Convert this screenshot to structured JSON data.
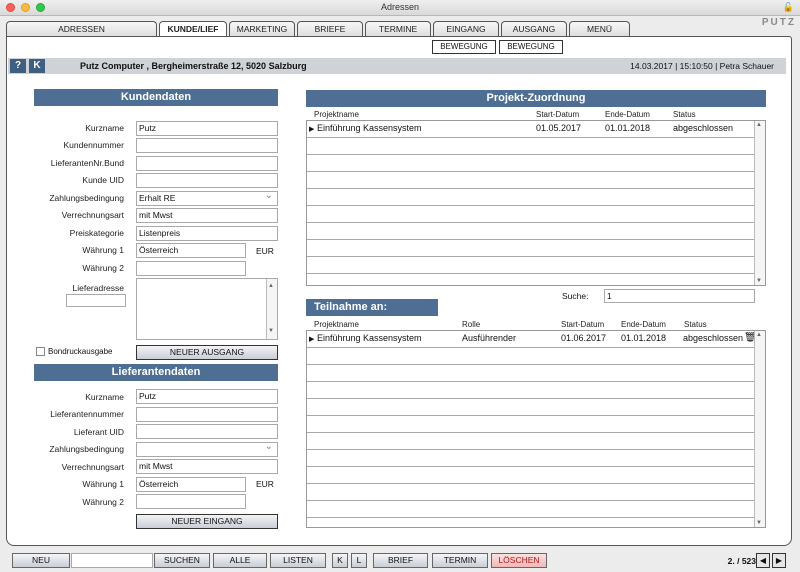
{
  "window": {
    "title": "Adressen",
    "logo": "PUTZ"
  },
  "tabs": [
    "ADRESSEN",
    "KUNDE/LIEF",
    "MARKETING",
    "BRIEFE",
    "TERMINE",
    "EINGANG",
    "AUSGANG",
    "MENÜ"
  ],
  "sub_buttons": [
    "BEWEGUNG",
    "BEWEGUNG"
  ],
  "header": {
    "help": "?",
    "k": "K",
    "company": "Putz Computer , Bergheimerstraße 12, 5020 Salzburg",
    "dateinfo": "14.03.2017 | 15:10:50 | Petra Schauer"
  },
  "kunden": {
    "title": "Kundendaten",
    "labels": {
      "kurzname": "Kurzname",
      "kundennummer": "Kundennummer",
      "lieferanten_bund": "LieferantenNr.Bund",
      "kunde_uid": "Kunde UID",
      "zahlungsbedingung": "Zahlungsbedingung",
      "verrechnungsart": "Verrechnungsart",
      "preiskategorie": "Preiskategorie",
      "waehrung1": "Währung 1",
      "waehrung2": "Währung 2",
      "lieferadresse": "Lieferadresse"
    },
    "values": {
      "kurzname": "Putz",
      "kundennummer": "",
      "lieferanten_bund": "",
      "kunde_uid": "",
      "zahlungsbedingung": "Erhalt RE",
      "verrechnungsart": "mit Mwst",
      "preiskategorie": "Listenpreis",
      "waehrung1": "Österreich",
      "waehrung1_unit": "EUR",
      "waehrung2": ""
    },
    "bondruck": "Bondruckausgabe",
    "button": "NEUER AUSGANG"
  },
  "lieferanten": {
    "title": "Lieferantendaten",
    "labels": {
      "kurzname": "Kurzname",
      "nummer": "Lieferantennummer",
      "uid": "Lieferant UID",
      "zahlungsbedingung": "Zahlungsbedingung",
      "verrechnungsart": "Verrechnungsart",
      "waehrung1": "Währung 1",
      "waehrung2": "Währung 2"
    },
    "values": {
      "kurzname": "Putz",
      "nummer": "",
      "uid": "",
      "zahlungsbedingung": "",
      "verrechnungsart": "mit Mwst",
      "waehrung1": "Österreich",
      "waehrung1_unit": "EUR",
      "waehrung2": ""
    },
    "button": "NEUER EINGANG"
  },
  "projekt": {
    "title": "Projekt-Zuordnung",
    "columns": [
      "Projektname",
      "Start-Datum",
      "Ende-Datum",
      "Status"
    ],
    "rows": [
      {
        "name": "Einführung Kassensystem",
        "start": "01.05.2017",
        "end": "01.01.2018",
        "status": "abgeschlossen"
      }
    ]
  },
  "suche": {
    "label": "Suche:",
    "value": "1"
  },
  "teilnahme": {
    "title": "Teilnahme an:",
    "columns": [
      "Projektname",
      "Rolle",
      "Start-Datum",
      "Ende-Datum",
      "Status"
    ],
    "rows": [
      {
        "name": "Einführung Kassensystem",
        "rolle": "Ausführender",
        "start": "01.06.2017",
        "end": "01.01.2018",
        "status": "abgeschlossen"
      }
    ]
  },
  "bottom": {
    "buttons": [
      "NEU",
      "SUCHEN",
      "ALLE",
      "LISTEN",
      "K",
      "L",
      "BRIEF",
      "TERMIN",
      "LÖSCHEN"
    ],
    "search_value": "",
    "pager": "2. / 523"
  },
  "colors": {
    "section": "#4e6f93",
    "headerbar": "#cfd3d8",
    "delete": "#b01818"
  }
}
